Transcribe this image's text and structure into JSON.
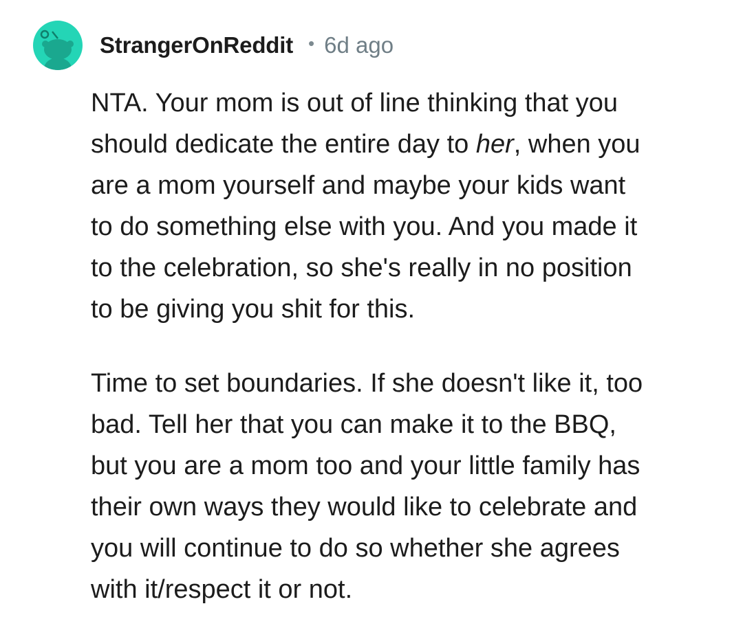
{
  "comment": {
    "author": "StrangerOnReddit",
    "separator": "•",
    "timestamp": "6d ago",
    "avatar_icon": "reddit-snoo-icon",
    "avatar_color": "#24d5b6",
    "paragraphs": [
      {
        "lines": [
          [
            "NTA. Your mom is out of line thinking that you"
          ],
          [
            "should dedicate the entire day to ",
            "her",
            ", when you"
          ],
          [
            "are a mom yourself and maybe your kids want"
          ],
          [
            "to do something else with you. And you made it"
          ],
          [
            "to the celebration, so she's really in no position"
          ],
          [
            "to be giving you shit for this."
          ]
        ]
      },
      {
        "lines": [
          [
            "Time to set boundaries. If she doesn't like it, too"
          ],
          [
            "bad. Tell her that you can make it to the BBQ,"
          ],
          [
            "but you are a mom too and your little family has"
          ],
          [
            "their own ways they would like to celebrate and"
          ],
          [
            "you will continue to do so whether she agrees"
          ],
          [
            "with it/respect it or not."
          ]
        ]
      }
    ]
  }
}
